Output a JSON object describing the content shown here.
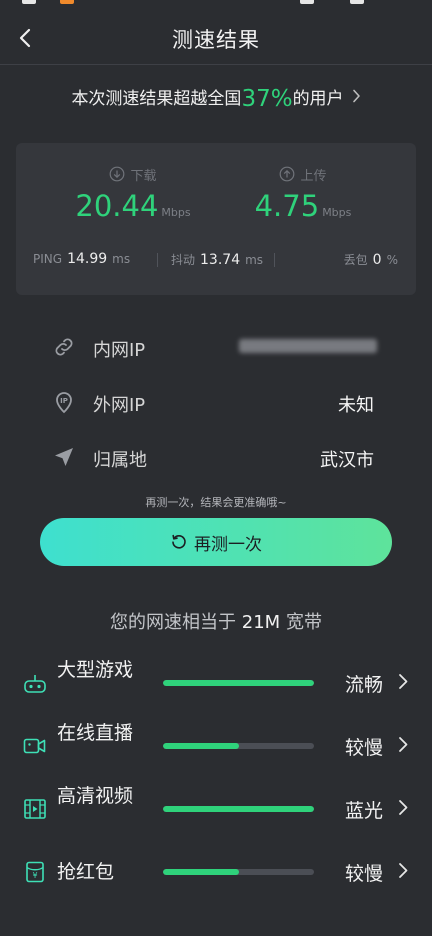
{
  "header": {
    "title": "测速结果"
  },
  "rank": {
    "prefix": "本次测速结果超越全国",
    "percent": "37%",
    "suffix": "的用户"
  },
  "speed": {
    "download": {
      "label": "下载",
      "value": "20.44",
      "unit": "Mbps"
    },
    "upload": {
      "label": "上传",
      "value": "4.75",
      "unit": "Mbps"
    },
    "ping": {
      "label": "PING",
      "value": "14.99",
      "unit": "ms"
    },
    "jitter": {
      "label": "抖动",
      "value": "13.74",
      "unit": "ms"
    },
    "loss": {
      "label": "丢包",
      "value": "0",
      "unit": "%"
    }
  },
  "network_info": [
    {
      "key": "内网IP",
      "value": "",
      "icon": "link-icon"
    },
    {
      "key": "外网IP",
      "value": "未知",
      "icon": "ip-pin-icon"
    },
    {
      "key": "归属地",
      "value": "武汉市",
      "icon": "location-arrow-icon"
    }
  ],
  "hint": "再测一次，结果会更准确哦~",
  "retest_button": {
    "label": "再测一次",
    "icon": "refresh-icon"
  },
  "equivalent": {
    "prefix": "您的网速相当于",
    "value": "21M",
    "suffix": "宽带"
  },
  "use_cases": [
    {
      "label": "大型游戏",
      "status": "流畅",
      "level": 1.0,
      "icon": "gamepad-icon"
    },
    {
      "label": "在线直播",
      "status": "较慢",
      "level": 0.5,
      "icon": "video-camera-icon"
    },
    {
      "label": "高清视频",
      "status": "蓝光",
      "level": 1.0,
      "icon": "film-icon"
    },
    {
      "label": "抢红包",
      "status": "较慢",
      "level": 0.5,
      "icon": "red-packet-icon"
    }
  ],
  "colors": {
    "accent": "#2fd27b",
    "background": "#2b2d31",
    "card": "#35373c",
    "button_start": "#3ee0cf",
    "button_end": "#5ee39b"
  }
}
